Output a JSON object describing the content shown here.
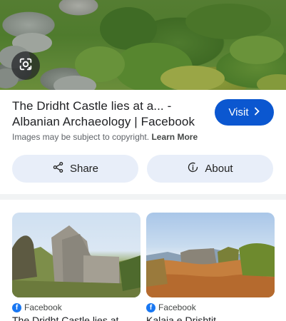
{
  "result": {
    "title_line1": "The Dridht Castle lies at a... -",
    "title_line2": "Albanian Archaeology | Facebook",
    "visit_label": "Visit",
    "copyright_text": "Images may be subject to copyright.",
    "learn_more": "Learn More"
  },
  "actions": {
    "share_label": "Share",
    "about_label": "About"
  },
  "related": [
    {
      "source": "Facebook",
      "title": "The Dridht Castle lies at..."
    },
    {
      "source": "Facebook",
      "title": "Kalaja e Drishtit"
    }
  ],
  "icons": {
    "lens": "google-lens-icon",
    "visit_arrow": "chevron-right-icon",
    "share": "share-icon",
    "about": "info-icon",
    "source": "facebook-icon"
  },
  "colors": {
    "visit_button": "#0b57d0",
    "pill_background": "#e8eef9",
    "facebook_blue": "#1877f2"
  }
}
